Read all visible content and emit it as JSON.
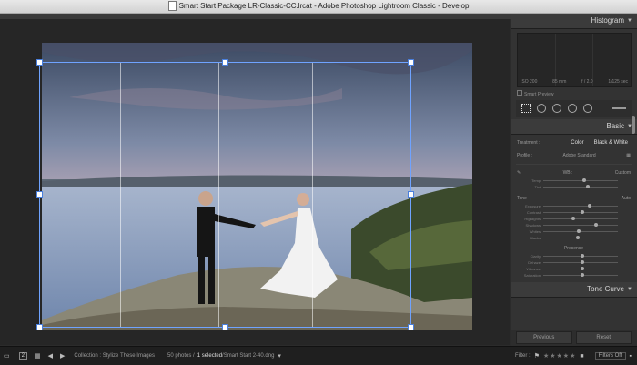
{
  "window": {
    "title": "Smart Start Package LR-Classic-CC.lrcat - Adobe Photoshop Lightroom Classic - Develop"
  },
  "histogram": {
    "title": "Histogram",
    "iso": "ISO 200",
    "focal": "85 mm",
    "aperture": "f / 2.0",
    "shutter": "1/125 sec",
    "smart_preview": "Smart Preview"
  },
  "basic": {
    "title": "Basic",
    "treatment_label": "Treatment :",
    "treatment_color": "Color",
    "treatment_bw": "Black & White",
    "profile_label": "Profile :",
    "profile_value": "Adobe Standard",
    "wb_label": "WB :",
    "wb_value": "Custom",
    "temp_label": "Temp",
    "tint_label": "Tint",
    "tone_label": "Tone",
    "tone_auto": "Auto",
    "exposure": "Exposure",
    "contrast": "Contrast",
    "highlights": "Highlights",
    "shadows": "Shadows",
    "whites": "Whites",
    "blacks": "Blacks",
    "presence_label": "Presence",
    "clarity": "Clarity",
    "dehaze": "Dehaze",
    "vibrance": "Vibrance",
    "saturation": "Saturation"
  },
  "tone_curve": {
    "title": "Tone Curve"
  },
  "buttons": {
    "previous": "Previous",
    "reset": "Reset"
  },
  "filmstrip": {
    "page_number": "2",
    "collection": "Collection : Stylize These Images",
    "count": "50 photos /",
    "selected": "1 selected",
    "file": "/Smart Start 2-40.dng",
    "filter_label": "Filter :",
    "filters_off": "Filters Off"
  }
}
